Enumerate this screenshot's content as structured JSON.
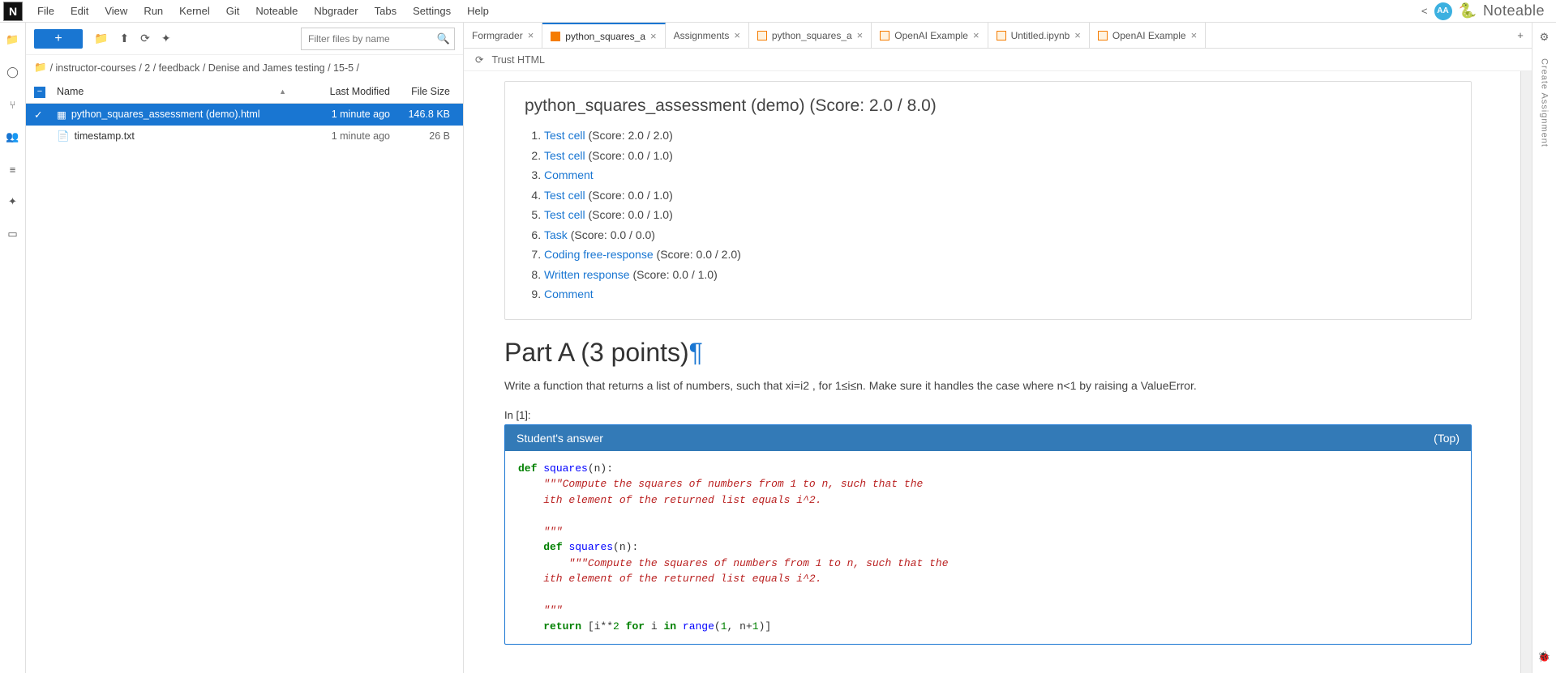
{
  "menu": [
    "File",
    "Edit",
    "View",
    "Run",
    "Kernel",
    "Git",
    "Noteable",
    "Nbgrader",
    "Tabs",
    "Settings",
    "Help"
  ],
  "avatar": "AA",
  "brand": "Noteable",
  "filter_placeholder": "Filter files by name",
  "breadcrumb": [
    "instructor-courses",
    "2",
    "feedback",
    "Denise and James testing",
    "15-5"
  ],
  "file_cols": {
    "name": "Name",
    "modified": "Last Modified",
    "size": "File Size"
  },
  "files": [
    {
      "name": "python_squares_assessment (demo).html",
      "modified": "1 minute ago",
      "size": "146.8 KB",
      "selected": true,
      "icon": "html"
    },
    {
      "name": "timestamp.txt",
      "modified": "1 minute ago",
      "size": "26 B",
      "selected": false,
      "icon": "file"
    }
  ],
  "tabs": [
    {
      "label": "Formgrader",
      "icon": "none",
      "active": false
    },
    {
      "label": "python_squares_a",
      "icon": "html",
      "active": true
    },
    {
      "label": "Assignments",
      "icon": "none",
      "active": false
    },
    {
      "label": "python_squares_a",
      "icon": "nb",
      "active": false
    },
    {
      "label": "OpenAI Example",
      "icon": "nb",
      "active": false
    },
    {
      "label": "Untitled.ipynb",
      "icon": "nb",
      "active": false
    },
    {
      "label": "OpenAI Example",
      "icon": "nb",
      "active": false
    }
  ],
  "trust_label": "Trust HTML",
  "doc_title": "python_squares_assessment (demo) (Score: 2.0 / 8.0)",
  "toc": [
    {
      "link": "Test cell",
      "score": "(Score: 2.0 / 2.0)"
    },
    {
      "link": "Test cell",
      "score": "(Score: 0.0 / 1.0)"
    },
    {
      "link": "Comment",
      "score": ""
    },
    {
      "link": "Test cell",
      "score": "(Score: 0.0 / 1.0)"
    },
    {
      "link": "Test cell",
      "score": "(Score: 0.0 / 1.0)"
    },
    {
      "link": "Task",
      "score": "(Score: 0.0 / 0.0)"
    },
    {
      "link": "Coding free-response",
      "score": "(Score: 0.0 / 2.0)"
    },
    {
      "link": "Written response",
      "score": "(Score: 0.0 / 1.0)"
    },
    {
      "link": "Comment",
      "score": ""
    }
  ],
  "part_heading": "Part A (3 points)",
  "part_desc": "Write a function that returns a list of numbers, such that xi=i2 , for 1≤i≤n. Make sure it handles the case where n<1 by raising a ValueError.",
  "in_prompt": "In [1]:",
  "answer_label": "Student's answer",
  "top_label": "(Top)",
  "right_label": "Create Assignment"
}
